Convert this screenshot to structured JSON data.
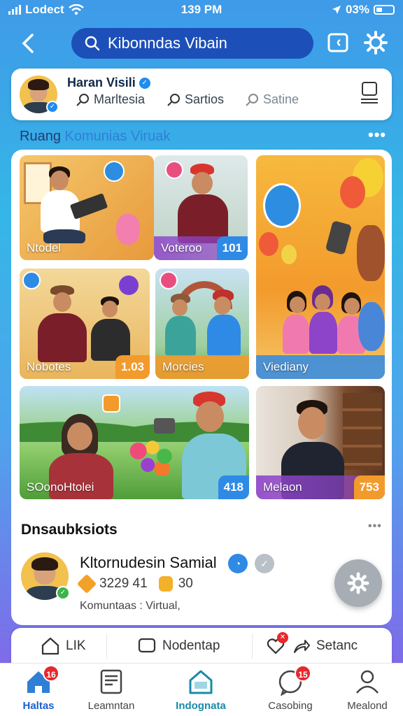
{
  "status_bar": {
    "carrier": "Lodect",
    "time": "139 PM",
    "battery": "03%"
  },
  "search": {
    "text": "Kibonndas Vibain"
  },
  "profile": {
    "name": "Haran Visili",
    "field1": "Marltesia",
    "field2": "Sartios",
    "field3": "Satine"
  },
  "section": {
    "title_part1": "Ruang ",
    "title_part2": "Komunias",
    "title_part3": " Viruak"
  },
  "tiles": [
    {
      "label": "Ntodel",
      "badge": ""
    },
    {
      "label": "Voteroo",
      "badge": "101"
    },
    {
      "label": "Viediany",
      "badge": ""
    },
    {
      "label": "Nobotes",
      "badge": "1.03"
    },
    {
      "label": "Morcies",
      "badge": ""
    },
    {
      "label": "SOonoHtolei",
      "badge": "418"
    },
    {
      "label": "Melaon",
      "badge": "753"
    }
  ],
  "lower": {
    "title": "Dnsaubksiots",
    "user_name": "Kltornudesin Samial",
    "stat1": "3229 41",
    "stat2": "30",
    "subtitle": "Komuntaas : Virtual,"
  },
  "actions": {
    "like": "LIK",
    "comment": "Nodentap",
    "share": "Setanc"
  },
  "tabs": [
    {
      "label": "Haltas",
      "badge": "16"
    },
    {
      "label": "Leamntan",
      "badge": ""
    },
    {
      "label": "Indognata",
      "badge": ""
    },
    {
      "label": "Casobing",
      "badge": "15"
    },
    {
      "label": "Mealond",
      "badge": ""
    }
  ],
  "colors": {
    "brand_blue": "#1d4fb8",
    "accent_orange": "#f39a2c",
    "accent_purple": "#8e44c9",
    "accent_blue": "#2f8ae6"
  }
}
